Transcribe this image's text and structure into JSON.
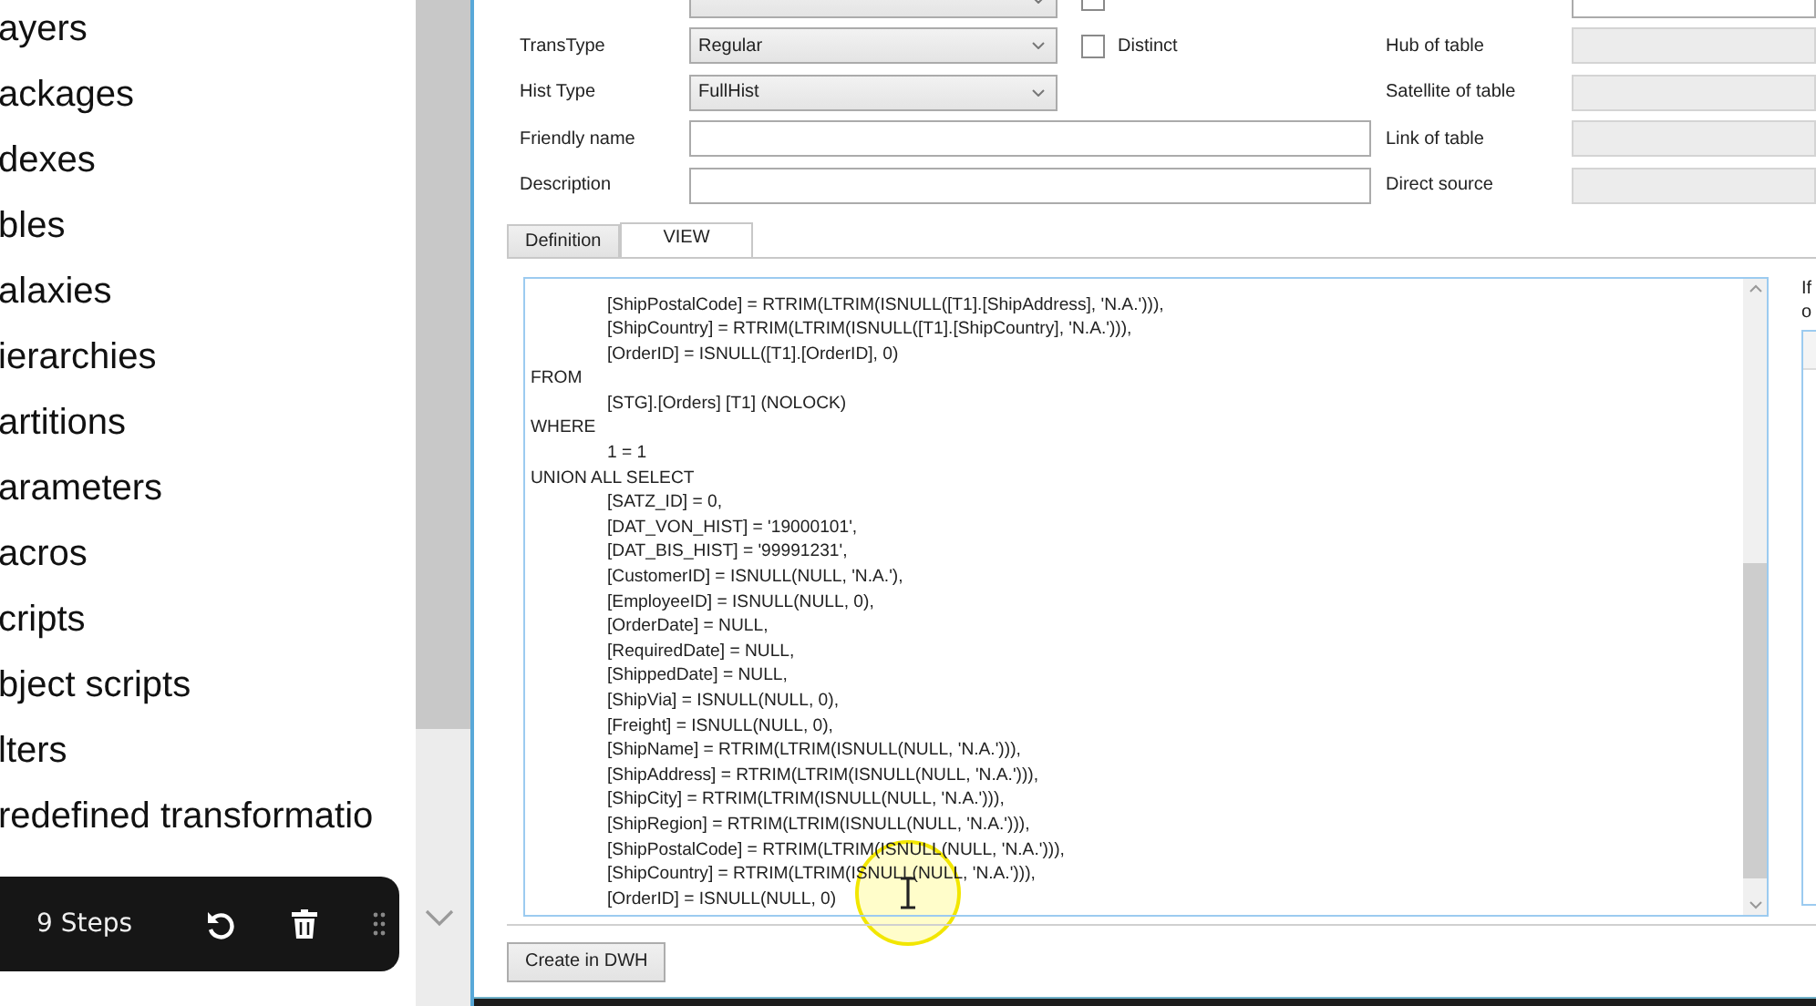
{
  "sidebar": {
    "items": [
      {
        "label": "ayers"
      },
      {
        "label": "ackages"
      },
      {
        "label": "dexes"
      },
      {
        "label": "bles"
      },
      {
        "label": "alaxies"
      },
      {
        "label": "ierarchies"
      },
      {
        "label": "artitions"
      },
      {
        "label": "arameters"
      },
      {
        "label": "acros"
      },
      {
        "label": "cripts"
      },
      {
        "label": "bject scripts"
      },
      {
        "label": "lters"
      },
      {
        "label": "redefined transformatio"
      }
    ]
  },
  "steps_toolbar": {
    "label": "9 Steps"
  },
  "form": {
    "rows": [
      {
        "kind": "combo",
        "check": {
          "checked": false
        },
        "right_disabled": false
      },
      {
        "kind": "combo",
        "label": "TransType",
        "value": "Regular",
        "check": {
          "label": "Distinct",
          "checked": false
        },
        "right_label": "Hub of table",
        "right_disabled": true
      },
      {
        "kind": "combo",
        "label": "Hist Type",
        "value": "FullHist",
        "right_label": "Satellite of table",
        "right_disabled": true
      },
      {
        "kind": "text",
        "label": "Friendly name",
        "right_label": "Link of table",
        "right_disabled": true
      },
      {
        "kind": "text",
        "label": "Description",
        "right_label": "Direct source",
        "right_disabled": true
      }
    ]
  },
  "tabs": [
    {
      "label": "Definition",
      "selected": false
    },
    {
      "label": "VIEW",
      "selected": true
    }
  ],
  "code_lines": [
    {
      "text": "[ShipPostalCode] = RTRIM(LTRIM(ISNULL([T1].[ShipAddress], 'N.A.'))),",
      "indented": true
    },
    {
      "text": "[ShipCountry] = RTRIM(LTRIM(ISNULL([T1].[ShipCountry], 'N.A.'))),",
      "indented": true
    },
    {
      "text": "[OrderID] = ISNULL([T1].[OrderID], 0)",
      "indented": true
    },
    {
      "text": "FROM",
      "indented": false
    },
    {
      "text": "[STG].[Orders] [T1] (NOLOCK)",
      "indented": true
    },
    {
      "text": "WHERE",
      "indented": false
    },
    {
      "text": "1 = 1",
      "indented": true
    },
    {
      "text": "UNION ALL SELECT",
      "indented": false
    },
    {
      "text": "[SATZ_ID] = 0,",
      "indented": true
    },
    {
      "text": "[DAT_VON_HIST] = '19000101',",
      "indented": true
    },
    {
      "text": "[DAT_BIS_HIST] = '99991231',",
      "indented": true
    },
    {
      "text": "[CustomerID] = ISNULL(NULL, 'N.A.'),",
      "indented": true
    },
    {
      "text": "[EmployeeID] = ISNULL(NULL, 0),",
      "indented": true
    },
    {
      "text": "[OrderDate] = NULL,",
      "indented": true
    },
    {
      "text": "[RequiredDate] = NULL,",
      "indented": true
    },
    {
      "text": "[ShippedDate] = NULL,",
      "indented": true
    },
    {
      "text": "[ShipVia] = ISNULL(NULL, 0),",
      "indented": true
    },
    {
      "text": "[Freight] = ISNULL(NULL, 0),",
      "indented": true
    },
    {
      "text": "[ShipName] = RTRIM(LTRIM(ISNULL(NULL, 'N.A.'))),",
      "indented": true
    },
    {
      "text": "[ShipAddress] = RTRIM(LTRIM(ISNULL(NULL, 'N.A.'))),",
      "indented": true
    },
    {
      "text": "[ShipCity] = RTRIM(LTRIM(ISNULL(NULL, 'N.A.'))),",
      "indented": true
    },
    {
      "text": "[ShipRegion] = RTRIM(LTRIM(ISNULL(NULL, 'N.A.'))),",
      "indented": true
    },
    {
      "text": "[ShipPostalCode] = RTRIM(LTRIM(ISNULL(NULL, 'N.A.'))),",
      "indented": true
    },
    {
      "text": "[ShipCountry] = RTRIM(LTRIM(ISNULL(NULL, 'N.A.'))),",
      "indented": true
    },
    {
      "text": "[OrderID] = ISNULL(NULL, 0)",
      "indented": true
    }
  ],
  "side_note": [
    "If",
    "o"
  ],
  "create_button": "Create in DWH"
}
